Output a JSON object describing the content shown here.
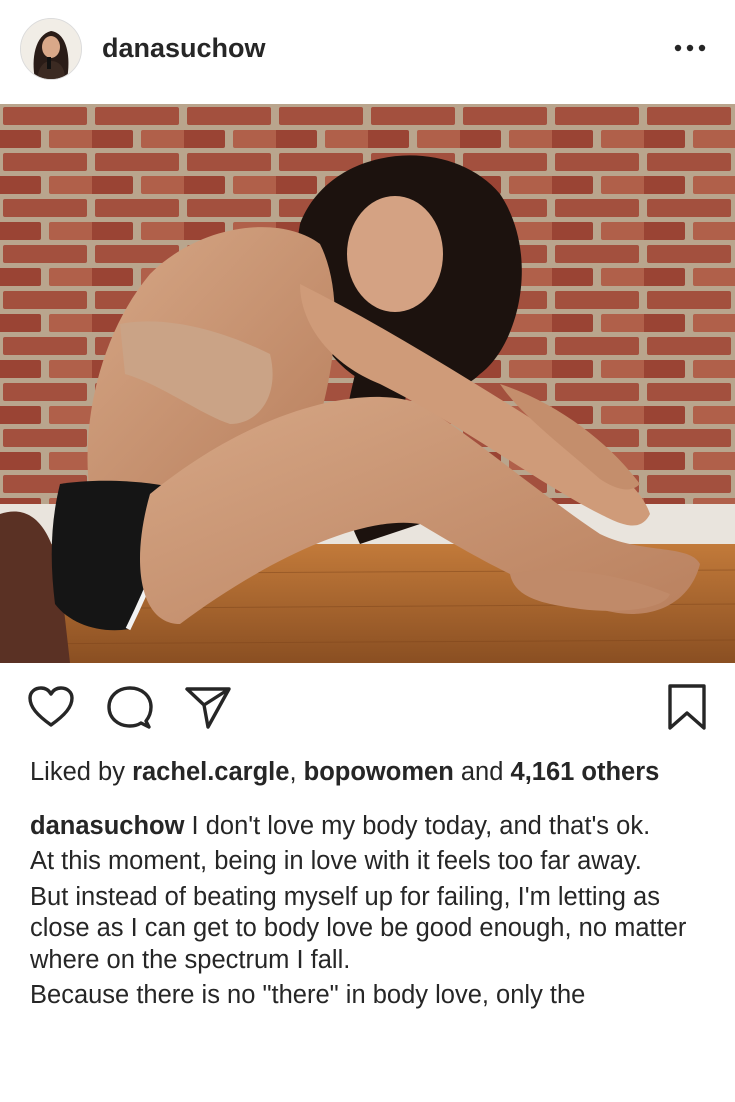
{
  "post": {
    "username": "danasuchow",
    "more_icon": "more-horizontal-icon"
  },
  "actions": {
    "like_icon": "heart-icon",
    "comment_icon": "comment-icon",
    "share_icon": "send-icon",
    "save_icon": "bookmark-icon"
  },
  "likes": {
    "prefix": "Liked by",
    "user1": "rachel.cargle",
    "separator": ",",
    "user2": "bopowomen",
    "and": "and",
    "others": "4,161 others"
  },
  "caption": {
    "username": "danasuchow",
    "line1": "I don't love my body today, and that's ok.",
    "line2": "At this moment, being in love with it feels too far away.",
    "line3": "But instead of beating myself up for failing, I'm letting as close as I can get to body love be good enough, no matter where on the spectrum I fall.",
    "line4": "Because there is no \"there\" in body love, only the"
  },
  "colors": {
    "text": "#262626",
    "brick": "#9c4a3a",
    "floor": "#a8662c"
  }
}
